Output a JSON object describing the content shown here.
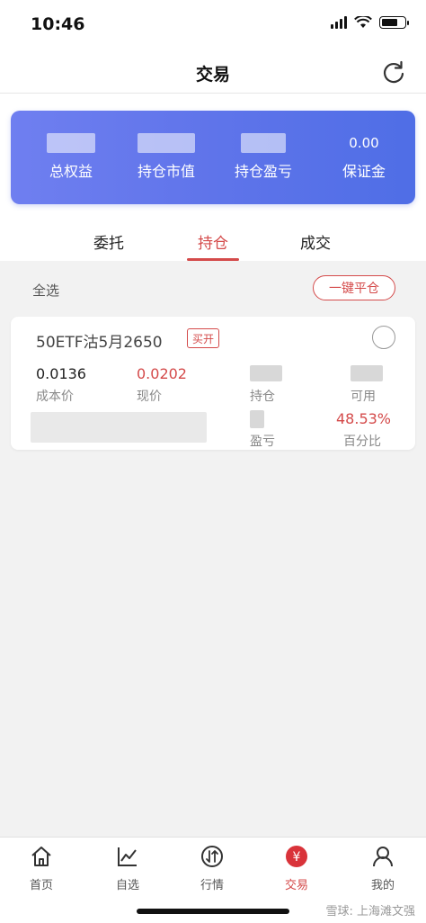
{
  "status": {
    "time": "10:46"
  },
  "nav": {
    "title": "交易"
  },
  "summary": {
    "items": [
      {
        "label": "总权益",
        "value": ""
      },
      {
        "label": "持仓市值",
        "value": ""
      },
      {
        "label": "持仓盈亏",
        "value": ""
      },
      {
        "label": "保证金",
        "value": "0.00"
      }
    ]
  },
  "tabs": [
    {
      "label": "委托",
      "active": false
    },
    {
      "label": "持仓",
      "active": true
    },
    {
      "label": "成交",
      "active": false
    }
  ],
  "toolbar": {
    "select_all": "全选",
    "close_all": "一键平仓"
  },
  "position": {
    "name": "50ETF沽5月2650",
    "side": "买开",
    "cost_price": "0.0136",
    "cost_price_label": "成本价",
    "current_price": "0.0202",
    "current_price_label": "现价",
    "holding_label": "持仓",
    "available_label": "可用",
    "pnl_label": "盈亏",
    "pct": "48.53%",
    "pct_label": "百分比"
  },
  "tabbar": [
    {
      "label": "首页",
      "icon": "home-icon"
    },
    {
      "label": "自选",
      "icon": "chart-icon"
    },
    {
      "label": "行情",
      "icon": "market-icon"
    },
    {
      "label": "交易",
      "icon": "trade-icon",
      "active": true
    },
    {
      "label": "我的",
      "icon": "user-icon"
    }
  ],
  "watermark": "雪球: 上海滩文强",
  "colors": {
    "accent": "#d44a4a",
    "card_gradient_start": "#6f7ff0",
    "card_gradient_end": "#4f6ee6"
  }
}
